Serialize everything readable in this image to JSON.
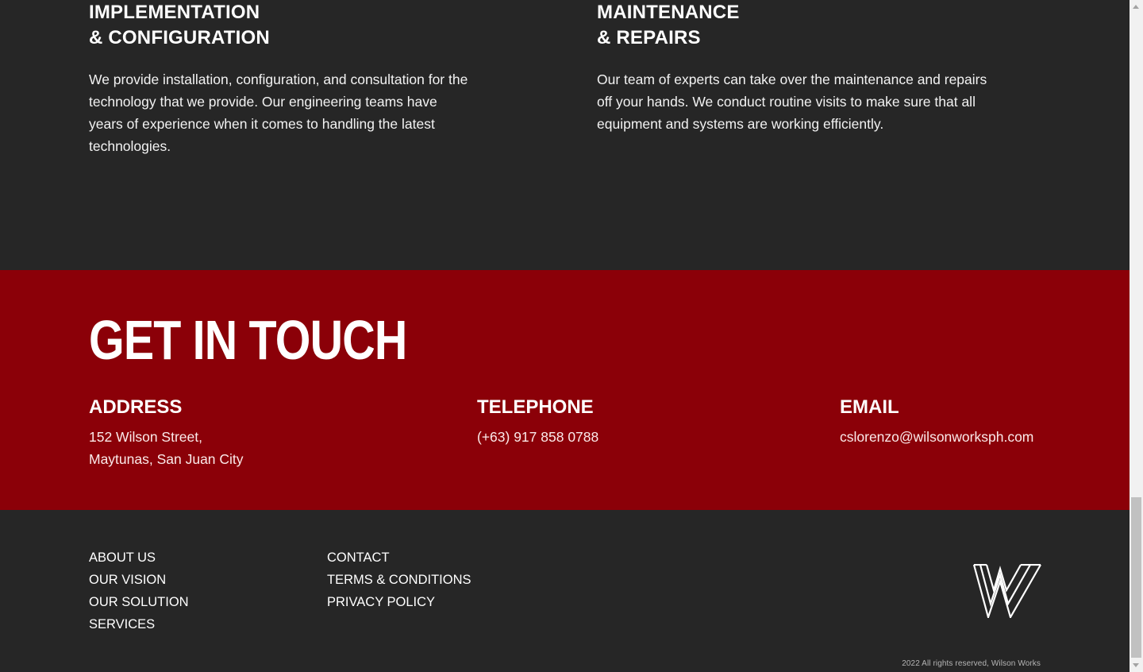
{
  "services": {
    "implementation": {
      "title_line1": "IMPLEMENTATION",
      "title_line2": "& CONFIGURATION",
      "body": "We provide installation, configuration, and consultation for the technology that we provide. Our engineering teams have years of experience when it comes to handling the latest technologies."
    },
    "maintenance": {
      "title_line1": "MAINTENANCE",
      "title_line2": "& REPAIRS",
      "body": "Our team of experts can take over the maintenance and repairs off your hands. We conduct routine visits to make sure that all equipment and systems are working efficiently."
    }
  },
  "contact": {
    "heading": "GET IN TOUCH",
    "background_color": "#8b0008",
    "address": {
      "label": "ADDRESS",
      "line1": "152 Wilson Street,",
      "line2": "Maytunas, San Juan City"
    },
    "telephone": {
      "label": "TELEPHONE",
      "value": "(+63) 917 858 0788"
    },
    "email": {
      "label": "EMAIL",
      "value": "cslorenzo@wilsonworksph.com"
    }
  },
  "footer": {
    "links_col1": [
      "ABOUT US",
      "OUR VISION",
      "OUR SOLUTION",
      "SERVICES"
    ],
    "links_col2": [
      "CONTACT",
      "TERMS & CONDITIONS",
      "PRIVACY POLICY"
    ],
    "logo_icon": "wilson-works-w-logo",
    "copyright": "2022 All rights reserved, Wilson Works"
  }
}
